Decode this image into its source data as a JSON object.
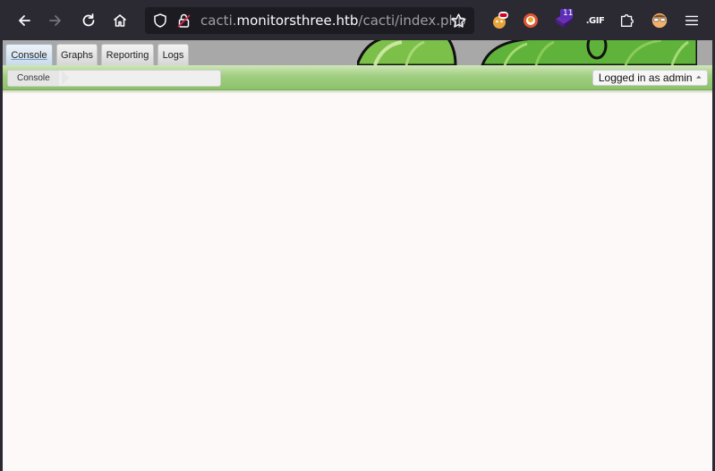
{
  "browser": {
    "url_subdomain": "cacti.",
    "url_host": "monitorsthree.htb",
    "url_path": "/cacti/index.php",
    "extension_badge_count": "11",
    "extension_gif_label": ".GIF"
  },
  "tabs": [
    {
      "label": "Console",
      "active": true
    },
    {
      "label": "Graphs",
      "active": false
    },
    {
      "label": "Reporting",
      "active": false
    },
    {
      "label": "Logs",
      "active": false
    }
  ],
  "breadcrumb": {
    "item": "Console"
  },
  "user_menu": {
    "label": "Logged in as admin",
    "caret": "⏶"
  },
  "colors": {
    "browser_bg": "#2b2a33",
    "urlbar_bg": "#1c1b22",
    "green_bar": "#9fce80",
    "page_bg": "#fdf9f8"
  }
}
